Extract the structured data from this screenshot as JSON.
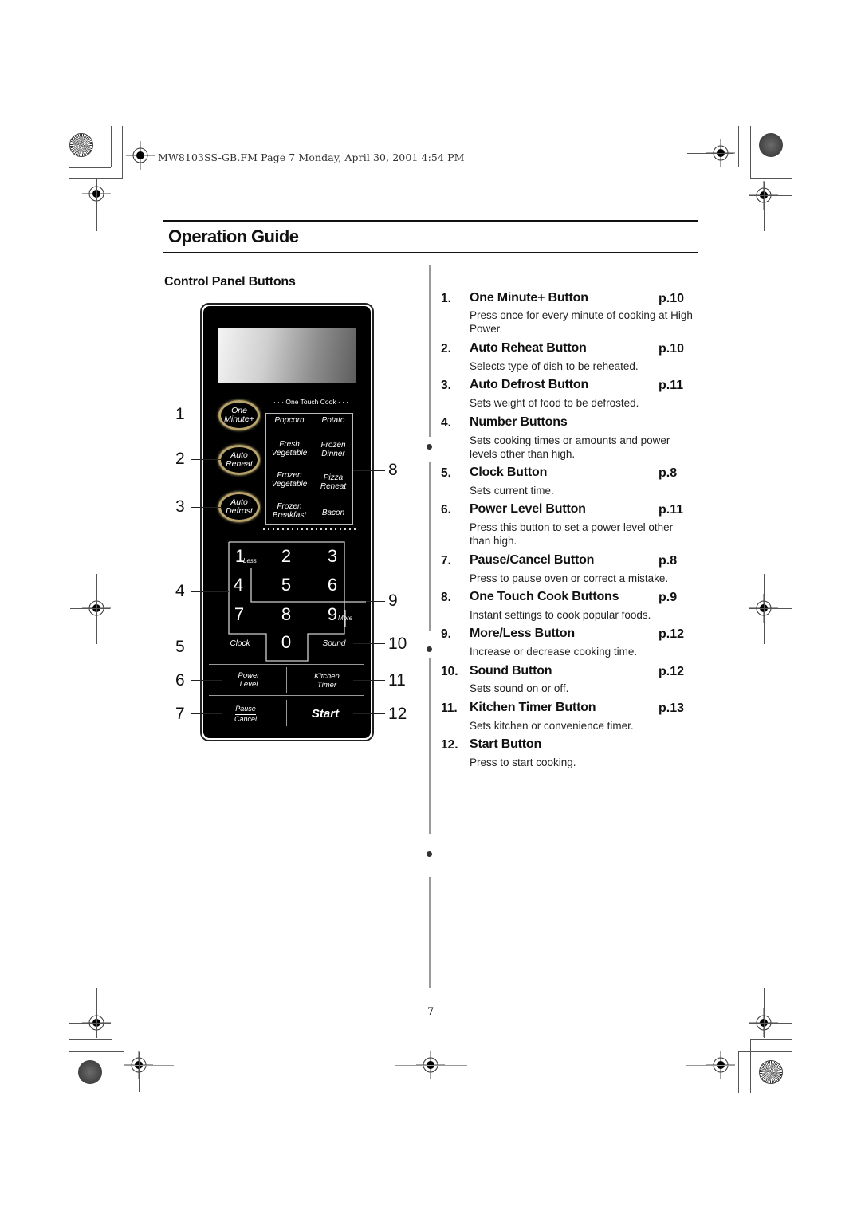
{
  "header_stamp": "MW8103SS-GB.FM  Page 7  Monday, April 30, 2001  4:54 PM",
  "page_title": "Operation Guide",
  "section_title": "Control Panel Buttons",
  "page_number": "7",
  "control_panel": {
    "one_touch_header": "· · ·  One Touch Cook  · · ·",
    "round_buttons": [
      {
        "line1": "One",
        "line2": "Minute+"
      },
      {
        "line1": "Auto",
        "line2": "Reheat"
      },
      {
        "line1": "Auto",
        "line2": "Defrost"
      }
    ],
    "one_touch_buttons": [
      {
        "line1": "Popcorn",
        "line2": ""
      },
      {
        "line1": "Potato",
        "line2": ""
      },
      {
        "line1": "Fresh",
        "line2": "Vegetable"
      },
      {
        "line1": "Frozen",
        "line2": "Dinner"
      },
      {
        "line1": "Frozen",
        "line2": "Vegetable"
      },
      {
        "line1": "Pizza",
        "line2": "Reheat"
      },
      {
        "line1": "Frozen",
        "line2": "Breakfast"
      },
      {
        "line1": "Bacon",
        "line2": ""
      }
    ],
    "number_keys": [
      "1",
      "2",
      "3",
      "4",
      "5",
      "6",
      "7",
      "8",
      "9",
      "0"
    ],
    "less_label": "Less",
    "more_label": "More",
    "clock_label": "Clock",
    "sound_label": "Sound",
    "power_level": {
      "line1": "Power",
      "line2": "Level"
    },
    "kitchen_timer": {
      "line1": "Kitchen",
      "line2": "Timer"
    },
    "pause_cancel": {
      "line1": "Pause",
      "line2": "Cancel"
    },
    "start_label": "Start",
    "callouts_left": [
      "1",
      "2",
      "3",
      "4",
      "5",
      "6",
      "7"
    ],
    "callouts_right": [
      "8",
      "9",
      "10",
      "11",
      "12"
    ]
  },
  "items": [
    {
      "num": "1.",
      "title": "One Minute+ Button",
      "page": "p.10",
      "desc": "Press once for every minute of cooking at High Power."
    },
    {
      "num": "2.",
      "title": "Auto Reheat Button",
      "page": "p.10",
      "desc": "Selects type of dish to be reheated."
    },
    {
      "num": "3.",
      "title": "Auto Defrost Button",
      "page": "p.11",
      "desc": "Sets weight of food to be defrosted."
    },
    {
      "num": "4.",
      "title": "Number Buttons",
      "page": "",
      "desc": "Sets cooking times or amounts and  power levels other than high."
    },
    {
      "num": "5.",
      "title": "Clock Button",
      "page": "p.8",
      "desc": "Sets current time."
    },
    {
      "num": "6.",
      "title": "Power Level Button",
      "page": "p.11",
      "desc": "Press this button to set a power level other than high."
    },
    {
      "num": "7.",
      "title": "Pause/Cancel Button",
      "page": "p.8",
      "desc": "Press to pause oven or correct a mistake."
    },
    {
      "num": "8.",
      "title": "One Touch Cook Buttons",
      "page": "p.9",
      "desc": "Instant settings to cook popular foods."
    },
    {
      "num": "9.",
      "title": "More/Less Button",
      "page": "p.12",
      "desc": "Increase or decrease cooking time."
    },
    {
      "num": "10.",
      "title": "Sound Button",
      "page": "p.12",
      "desc": "Sets sound on or off."
    },
    {
      "num": "11.",
      "title": "Kitchen Timer Button",
      "page": "p.13",
      "desc": "Sets kitchen or convenience timer."
    },
    {
      "num": "12.",
      "title": "Start Button",
      "page": "",
      "desc": "Press to start cooking."
    }
  ]
}
